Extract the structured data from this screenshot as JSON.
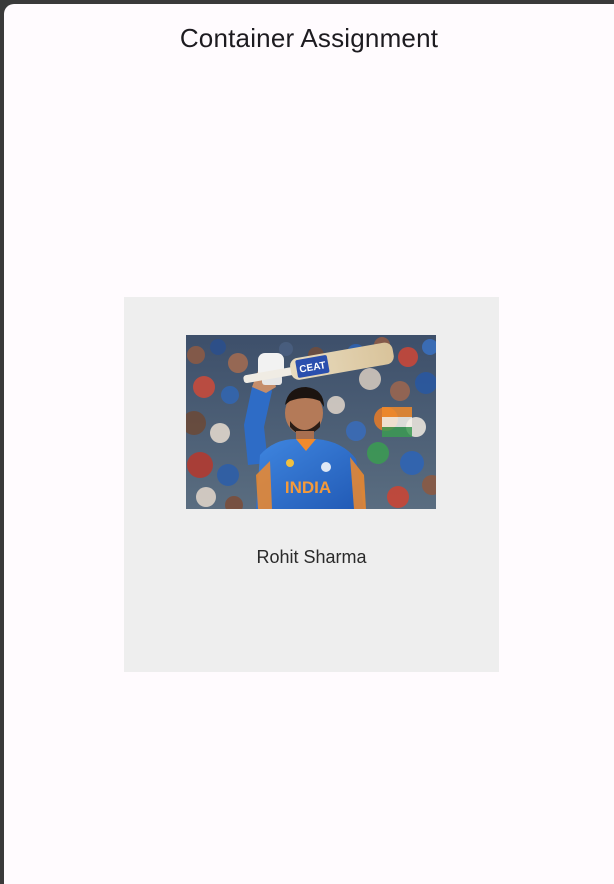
{
  "app": {
    "title": "Container Assignment"
  },
  "card": {
    "name": "Rohit Sharma",
    "background_color": "#eeeeee",
    "image_icon": "cricketer-photo"
  },
  "photo": {
    "jersey_text": "INDIA",
    "bat_text": "CEAT"
  },
  "colors": {
    "page_background": "#fffbfe",
    "frame": "#3a3a3a",
    "jersey_blue": "#2f6fcb"
  }
}
